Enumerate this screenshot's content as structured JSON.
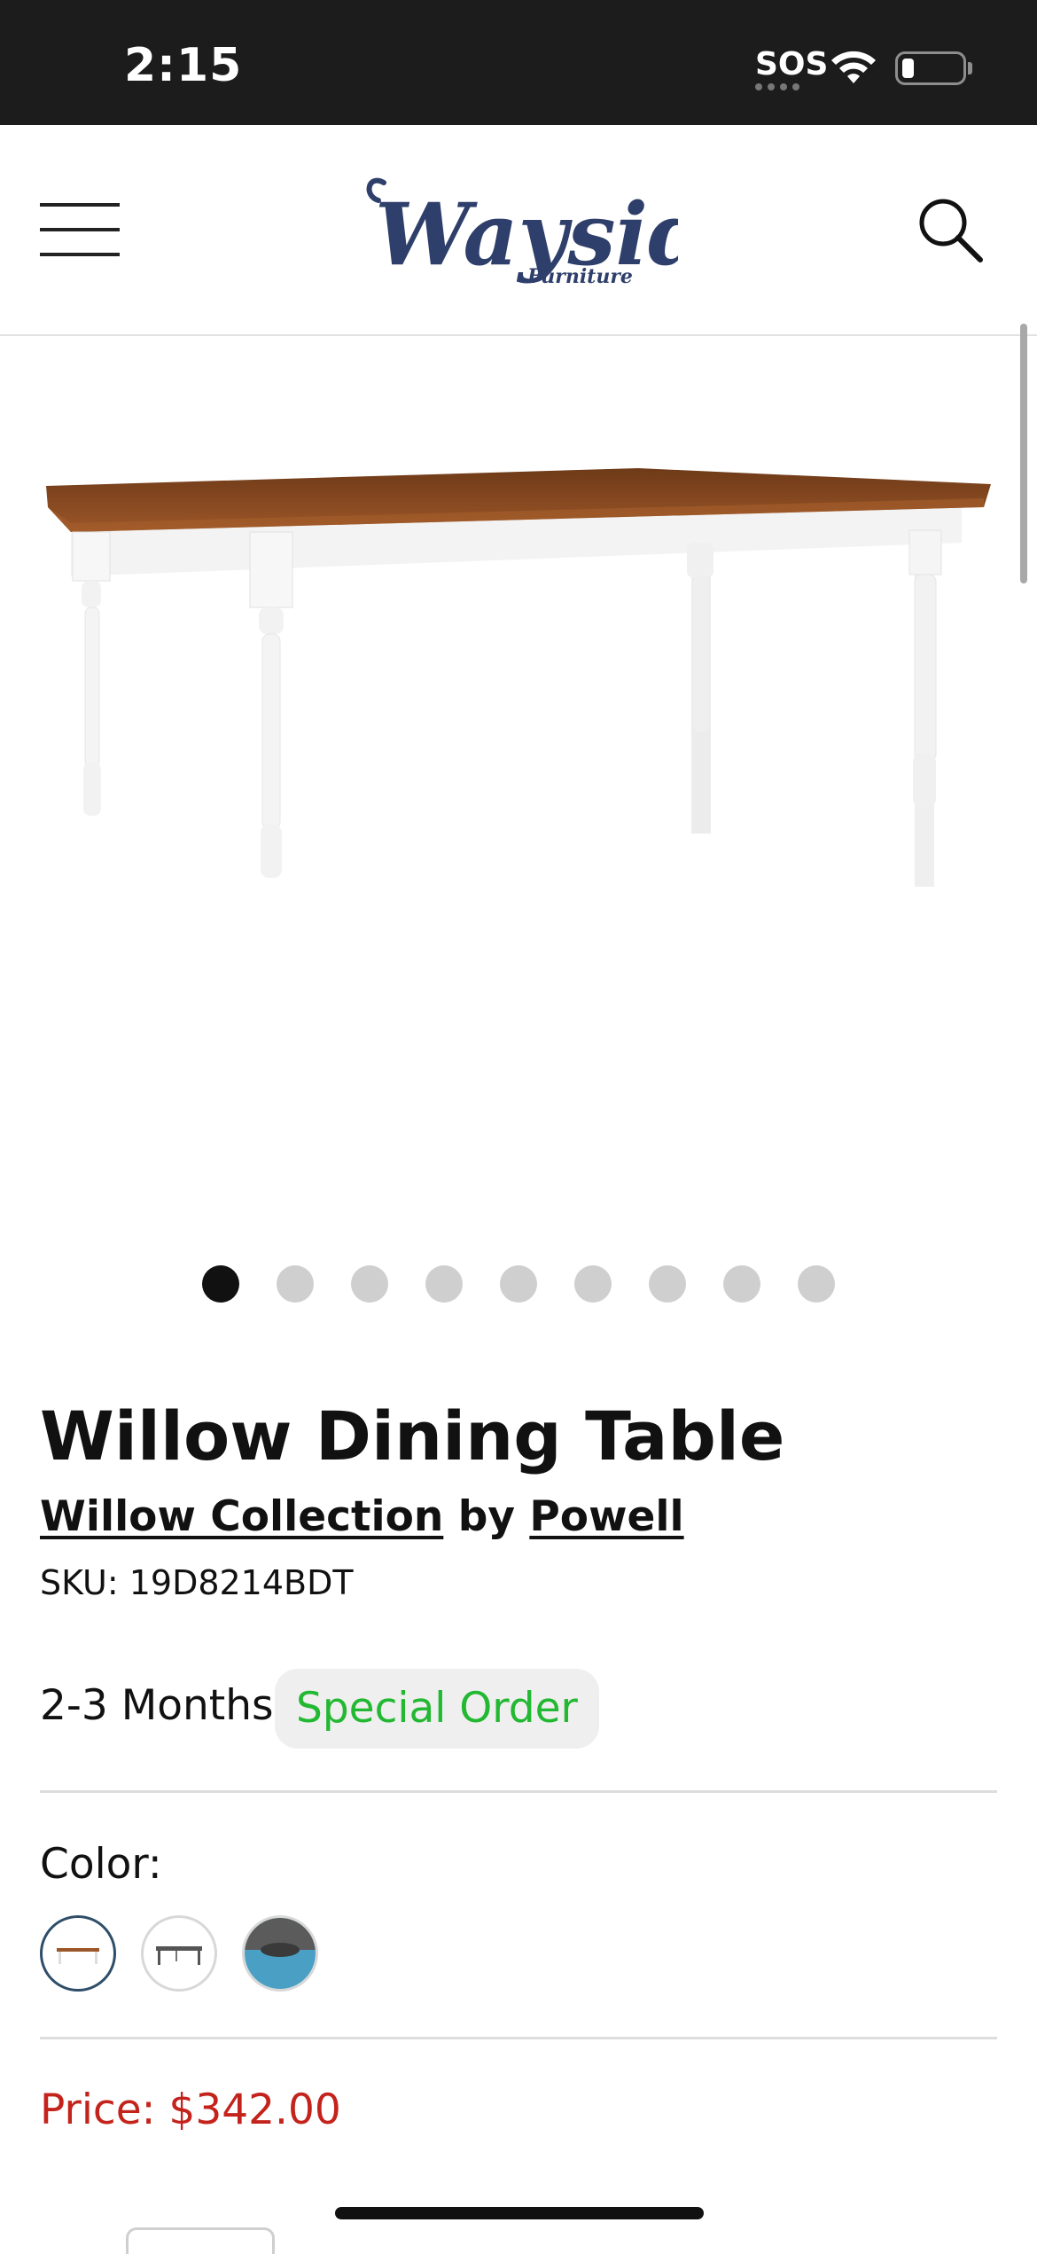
{
  "status_bar": {
    "time": "2:15",
    "sos": "SOS",
    "battery_level": 0.2
  },
  "header": {
    "logo_text": "Wayside",
    "logo_subtext": "Furniture"
  },
  "carousel": {
    "total": 9,
    "active_index": 0
  },
  "product": {
    "title": "Willow Dining Table",
    "collection": "Willow Collection",
    "by": "by",
    "brand": "Powell",
    "sku": "SKU: 19D8214BDT",
    "lead_time": "2-3 Months",
    "order_type": "Special Order",
    "color_label": "Color:",
    "swatches": [
      "table-white-oak",
      "table-dark-frame",
      "round-table-blue"
    ],
    "selected_swatch": 0,
    "price": "Price: $342.00"
  },
  "colors": {
    "status_bar_bg": "#1c1c1c",
    "logo_navy": "#2f3f6b",
    "special_order_green": "#22b832",
    "price_red": "#c4231c",
    "swatch_selected_border": "#2f4e69",
    "table_top": "#8a4a1e",
    "table_legs": "#f5f5f5"
  }
}
